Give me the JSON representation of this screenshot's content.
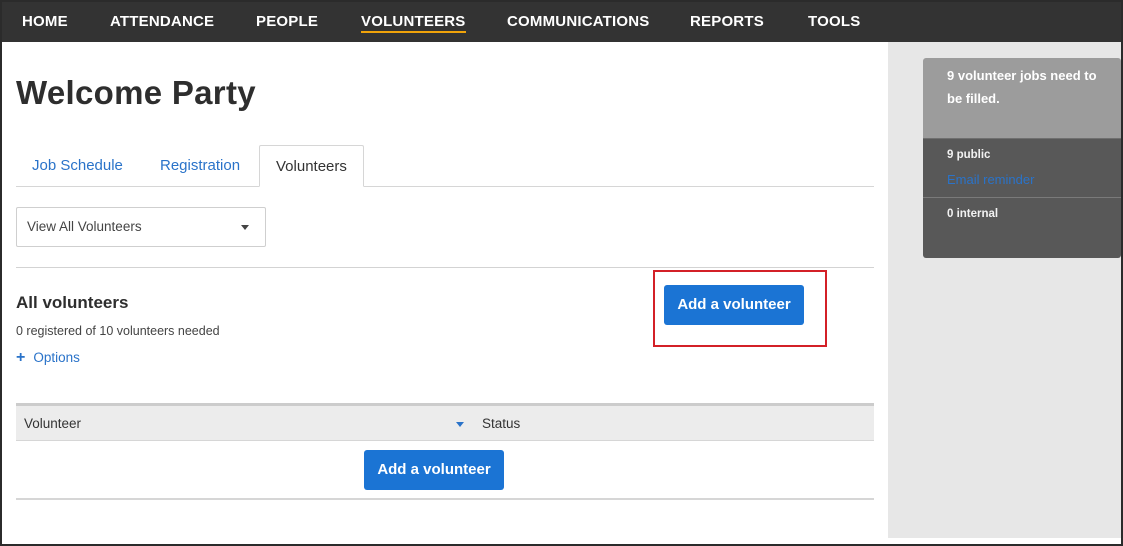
{
  "nav": {
    "items": [
      {
        "label": "HOME"
      },
      {
        "label": "ATTENDANCE"
      },
      {
        "label": "PEOPLE"
      },
      {
        "label": "VOLUNTEERS"
      },
      {
        "label": "COMMUNICATIONS"
      },
      {
        "label": "REPORTS"
      },
      {
        "label": "TOOLS"
      }
    ],
    "active": "VOLUNTEERS",
    "underline_color": "#f0a30a"
  },
  "page": {
    "title": "Welcome Party"
  },
  "tabs": [
    {
      "label": "Job Schedule"
    },
    {
      "label": "Registration"
    },
    {
      "label": "Volunteers"
    }
  ],
  "active_tab": "Volunteers",
  "filter": {
    "selected": "View All Volunteers"
  },
  "section": {
    "title": "All volunteers",
    "subtitle": "0 registered of 10 volunteers needed",
    "options_label": "Options",
    "add_button_label": "Add a volunteer"
  },
  "table": {
    "columns": [
      "Volunteer",
      "Status"
    ],
    "empty_button_label": "Add a volunteer"
  },
  "sidebar": {
    "summary": "9 volunteer jobs need to be filled.",
    "public_count": "9 public",
    "email_link": "Email reminder",
    "internal_count": "0 internal"
  },
  "colors": {
    "nav_bg": "#333333",
    "link": "#2a73c9",
    "button": "#1b74d4",
    "highlight": "#d32027"
  }
}
